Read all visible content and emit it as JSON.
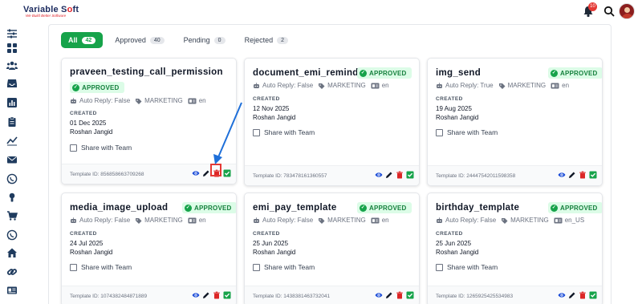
{
  "header": {
    "logo_main_a": "Variable S",
    "logo_main_o": "o",
    "logo_main_b": "ft",
    "logo_tagline": "We Build Better Software",
    "notification_count": "10"
  },
  "sidebar": {
    "icons": [
      "sliders-icon",
      "dashboard-grid-icon",
      "users-group-icon",
      "inbox-icon",
      "bar-chart-icon",
      "clipboard-icon",
      "trend-line-icon",
      "mail-icon",
      "whatsapp-icon",
      "bulb-icon",
      "cart-icon",
      "whatsapp-alt-icon",
      "home-icon",
      "link-icon",
      "id-card-icon"
    ]
  },
  "tabs": [
    {
      "label": "All",
      "count": "42",
      "active": true
    },
    {
      "label": "Approved",
      "count": "40",
      "active": false
    },
    {
      "label": "Pending",
      "count": "0",
      "active": false
    },
    {
      "label": "Rejected",
      "count": "2",
      "active": false
    }
  ],
  "labels": {
    "approved": "APPROVED",
    "created": "CREATED",
    "share": "Share with Team"
  },
  "cards": [
    {
      "title": "praveen_testing_call_permission",
      "auto_reply": "Auto Reply: False",
      "category": "MARKETING",
      "lang": "en",
      "date": "01 Dec 2025",
      "author": "Roshan Jangid",
      "template_id": "Template ID: 856858663709268"
    },
    {
      "title": "document_emi_remindor",
      "auto_reply": "Auto Reply: False",
      "category": "MARKETING",
      "lang": "en",
      "date": "12 Nov 2025",
      "author": "Roshan Jangid",
      "template_id": "Template ID: 783478161360557"
    },
    {
      "title": "img_send",
      "auto_reply": "Auto Reply: True",
      "category": "MARKETING",
      "lang": "en",
      "date": "19 Aug 2025",
      "author": "Roshan Jangid",
      "template_id": "Template ID: 24447542011598358"
    },
    {
      "title": "media_image_upload",
      "auto_reply": "Auto Reply: False",
      "category": "MARKETING",
      "lang": "en",
      "date": "24 Jul 2025",
      "author": "Roshan Jangid",
      "template_id": "Template ID: 1074382484871889"
    },
    {
      "title": "emi_pay_template",
      "auto_reply": "Auto Reply: False",
      "category": "MARKETING",
      "lang": "en",
      "date": "25 Jun 2025",
      "author": "Roshan Jangid",
      "template_id": "Template ID: 1438381463732041"
    },
    {
      "title": "birthday_template",
      "auto_reply": "Auto Reply: False",
      "category": "MARKETING",
      "lang": "en_US",
      "date": "25 Jun 2025",
      "author": "Roshan Jangid",
      "template_id": "Template ID: 1265925425534983"
    }
  ],
  "colors": {
    "accent_green": "#16a34a",
    "view_blue": "#1d4ed8",
    "delete_red": "#dc2626",
    "annotation_blue": "#1e6fd9",
    "annotation_red": "#e53935"
  }
}
